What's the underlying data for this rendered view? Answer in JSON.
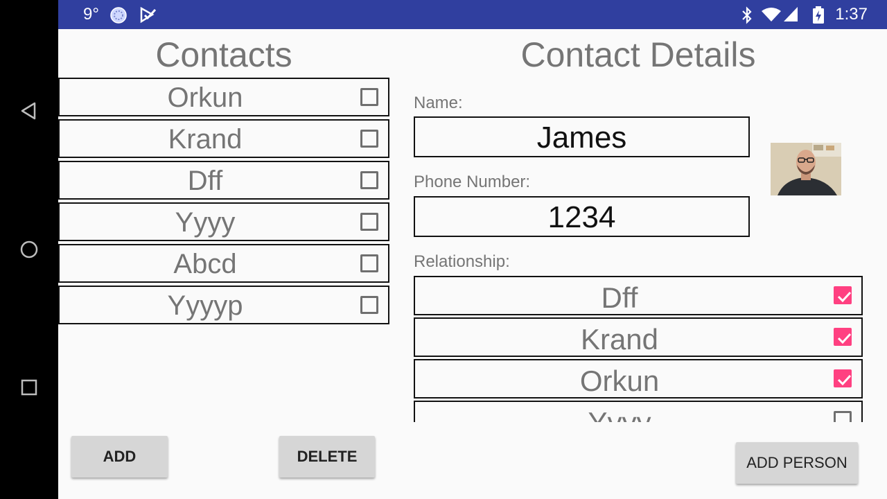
{
  "status_bar": {
    "temperature": "9°",
    "time": "1:37",
    "icons": [
      "weather-icon",
      "check-notification-icon",
      "bluetooth-icon",
      "wifi-icon",
      "signal-icon",
      "battery-icon"
    ]
  },
  "contacts": {
    "title": "Contacts",
    "items": [
      {
        "name": "Orkun",
        "checked": false
      },
      {
        "name": "Krand",
        "checked": false
      },
      {
        "name": "Dff",
        "checked": false
      },
      {
        "name": "Yyyy",
        "checked": false
      },
      {
        "name": "Abcd",
        "checked": false
      },
      {
        "name": "Yyyyp",
        "checked": false
      }
    ]
  },
  "details": {
    "title": "Contact Details",
    "name_label": "Name:",
    "name_value": "James",
    "phone_label": "Phone Number:",
    "phone_value": "1234",
    "relationship_label": "Relationship:",
    "relationships": [
      {
        "name": "Dff",
        "checked": true
      },
      {
        "name": "Krand",
        "checked": true
      },
      {
        "name": "Orkun",
        "checked": true
      },
      {
        "name": "Yyyy",
        "checked": false
      }
    ]
  },
  "buttons": {
    "add": "ADD",
    "delete": "DELETE",
    "add_person": "ADD PERSON"
  },
  "colors": {
    "status_bar": "#303f9f",
    "accent": "#ff4081",
    "nav_bar": "#000000"
  }
}
